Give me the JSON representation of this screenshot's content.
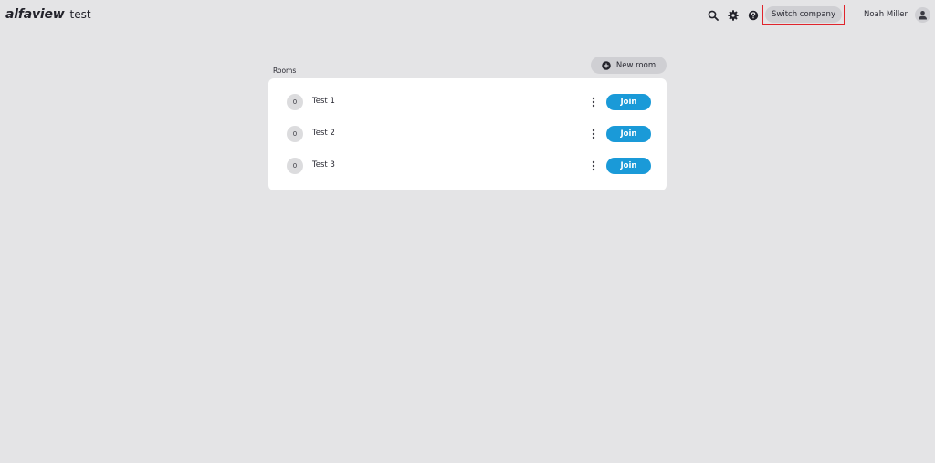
{
  "header": {
    "logo": "alfaview",
    "company": "test",
    "icons": [
      "search-icon",
      "gear-icon",
      "help-icon"
    ],
    "switch_company_label": "Switch company",
    "user_name": "Noah Miller",
    "avatar_icon": "user-icon"
  },
  "main": {
    "section_label": "Rooms",
    "new_room_label": "New room",
    "new_room_icon": "plus-circle-icon",
    "rooms": [
      {
        "count": "0",
        "name": "Test 1",
        "join_label": "Join"
      },
      {
        "count": "0",
        "name": "Test 2",
        "join_label": "Join"
      },
      {
        "count": "0",
        "name": "Test 3",
        "join_label": "Join"
      }
    ]
  },
  "colors": {
    "background": "#e4e4e6",
    "card": "#ffffff",
    "accent": "#1a9ad8",
    "highlight_frame": "#e0242c",
    "pill": "#cfcfd3"
  }
}
